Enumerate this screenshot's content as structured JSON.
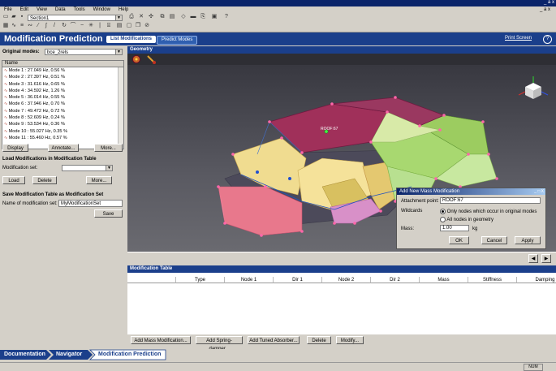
{
  "window": {
    "min_max_close": "_ a x"
  },
  "menu": {
    "items": [
      "File",
      "Edit",
      "View",
      "Data",
      "Tools",
      "Window",
      "Help"
    ],
    "doc_buttons": "_ a x"
  },
  "toolbar": {
    "section_value": "Section1"
  },
  "module": {
    "title": "Modification Prediction",
    "tabs": [
      "List Modifications",
      "Predict Modes"
    ],
    "print_screen": "Print Screen",
    "help": "?"
  },
  "left": {
    "original_modes_label": "Original modes:",
    "original_modes_value": "bce_2rels",
    "list_header": "Name",
    "modes": [
      "Mode 1 : 27.049 Hz, 0.56 %",
      "Mode 2 : 27.397 Hz, 0.51 %",
      "Mode 3 : 31.616 Hz, 0.65 %",
      "Mode 4 : 34.592 Hz, 1.26 %",
      "Mode 5 : 36.014 Hz, 0.55 %",
      "Mode 6 : 37.946 Hz, 0.70 %",
      "Mode 7 : 49.472 Hz, 0.72 %",
      "Mode 8 : 52.609 Hz, 0.24 %",
      "Mode 9 : 53.534 Hz, 0.36 %",
      "Mode 10 : 55.027 Hz, 0.35 %",
      "Mode 11 : 55.460 Hz, 0.57 %"
    ],
    "display_btn": "Display",
    "annotate_btn": "Annotate...",
    "more_btn": "More...",
    "load_section_title": "Load Modifications in Modification Table",
    "mod_set_label": "Modification set:",
    "load_btn": "Load",
    "delete_btn": "Delete",
    "more_btn2": "More...",
    "save_section_title": "Save Modification Table as Modification Set",
    "name_label": "Name of modification set:",
    "name_value": "MyModificationSet",
    "save_btn": "Save"
  },
  "geometry": {
    "title": "Geometry",
    "node_label": "ROOF:67"
  },
  "dialog": {
    "title": "Add New Mass Modification",
    "attach_label": "Attachment point:",
    "attach_value": "ROOF:67",
    "wildcards_label": "Wildcards",
    "option1": "Only nodes which occur in original modes",
    "option2": "All nodes in geometry",
    "mass_label": "Mass:",
    "mass_value": "1.00",
    "mass_unit": "kg",
    "ok": "OK",
    "cancel": "Cancel",
    "apply": "Apply",
    "title_buttons": "_ □ X"
  },
  "mod_table": {
    "title": "Modification Table",
    "columns": [
      "",
      "Type",
      "Node 1",
      "Dir 1",
      "Node 2",
      "Dir 2",
      "Mass",
      "Stiffness",
      "Damping"
    ],
    "buttons": [
      "Add Mass Modification...",
      "Add Spring-damper...",
      "Add Tuned Absorber...",
      "Delete",
      "Modify..."
    ]
  },
  "breadcrumb": [
    "Documentation",
    "Navigator",
    "Modification Prediction"
  ],
  "status": {
    "num": "NUM"
  },
  "colors": {
    "header_blue": "#1b3f8b",
    "panel_gray": "#d4d0c8"
  }
}
